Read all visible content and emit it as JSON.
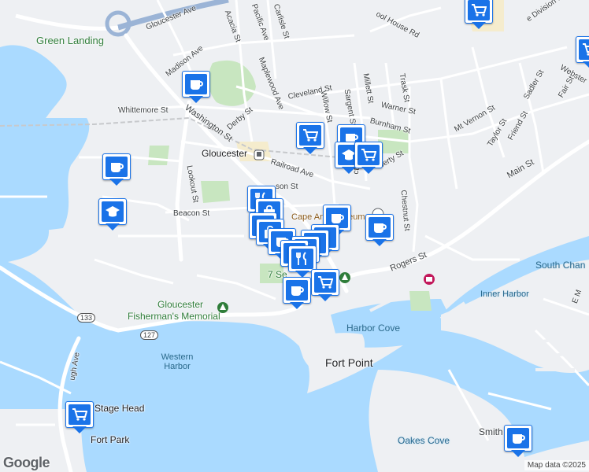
{
  "map": {
    "google_logo": "Google",
    "attribution": "Map data ©2025",
    "places": {
      "green_landing": "Green Landing",
      "gloucester_station": "Gloucester",
      "cape_ann_museum": "Cape Ann Museum",
      "seven_seas": "7 Se",
      "fishermans_memorial_1": "Gloucester",
      "fishermans_memorial_2": "Fisherman's Memorial",
      "western_harbor": "Western Harbor",
      "harbor_cove": "Harbor Cove",
      "fort_point": "Fort Point",
      "inner_harbor": "Inner Harbor",
      "south_channel": "South Chan",
      "oakes_cove": "Oakes Cove",
      "stage_head": "Stage Head",
      "stage_fort_park": "Fort Park",
      "smith": "Smith"
    },
    "streets": {
      "gloucester_ave": "Gloucester Ave",
      "acacia": "Acacia St",
      "pacific": "Pacific Ave",
      "carlisle": "Carlisle St",
      "madison": "Madison Ave",
      "maplewood": "Maplewood Ave",
      "cleveland": "Cleveland St",
      "derby": "Derby St",
      "whittemore": "Whittemore St",
      "washington": "Washington St",
      "railroad": "Railroad Ave",
      "lookout": "Lookout St",
      "beacon": "Beacon St",
      "emerson": "son St",
      "willow": "Willow St",
      "sargent": "Sargent St",
      "millett": "Millett St",
      "trask": "Trask St",
      "warner": "Warner St",
      "burnham": "Burnham St",
      "mt_vernon": "Mt Vernon St",
      "taylor": "Taylor St",
      "friend": "Friend St",
      "sadler": "Sadler St",
      "fair": "Fair St",
      "webster": "Webster",
      "main": "Main St",
      "chestnut": "Chestnut St",
      "rogers": "Rogers St",
      "school_house": "ool House Rd",
      "prospect": "ct St",
      "liberty": "berty St",
      "lough": "ugh Ave",
      "division": "e Division H",
      "route_133": "133",
      "route_127": "127",
      "e_main": "E M"
    },
    "colors": {
      "water": "#aadaff",
      "land": "#eef0f3",
      "park": "#c8e6c0",
      "road": "#ffffff",
      "highway": "#9bb4d6",
      "pin_accent": "#1a73e8"
    }
  }
}
